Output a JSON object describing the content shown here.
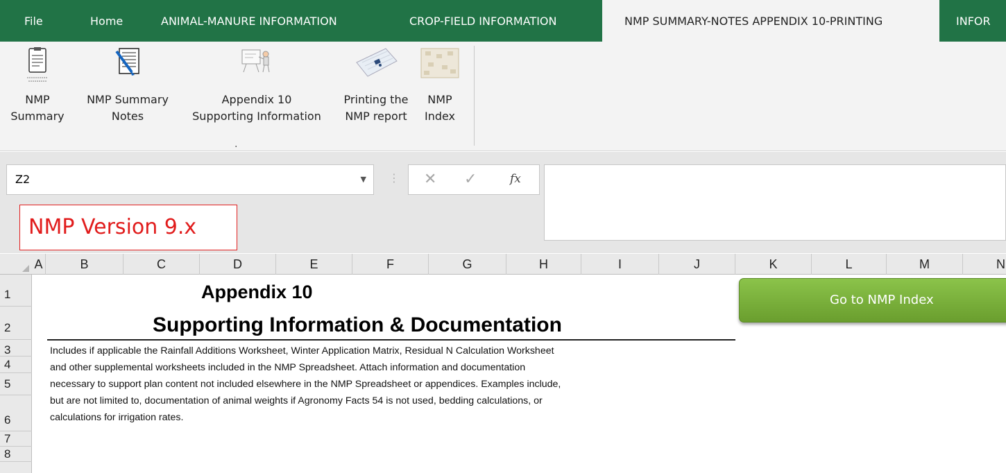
{
  "ribbon_tabs": [
    {
      "label": "File"
    },
    {
      "label": "Home"
    },
    {
      "label": "ANIMAL-MANURE INFORMATION"
    },
    {
      "label": "CROP-FIELD INFORMATION"
    },
    {
      "label": "NMP SUMMARY-NOTES APPENDIX 10-PRINTING",
      "active": true
    },
    {
      "label": "INFOR"
    }
  ],
  "ribbon_buttons": [
    {
      "line1": "NMP",
      "line2": "Summary",
      "icon": "summary-doc-icon"
    },
    {
      "line1": "NMP Summary",
      "line2": "Notes",
      "icon": "notes-doc-icon"
    },
    {
      "line1": "Appendix 10",
      "line2": "Supporting Information",
      "icon": "presentation-icon"
    },
    {
      "line1": "Printing the",
      "line2": "NMP report",
      "icon": "keyboard-icon"
    },
    {
      "line1": "NMP",
      "line2": "Index",
      "icon": "index-cards-icon"
    }
  ],
  "ribbon_group_label": ".",
  "formula_bar": {
    "name_box": "Z2",
    "cancel_glyph": "✕",
    "enter_glyph": "✓",
    "fx_glyph": "fx",
    "formula": ""
  },
  "version_label": "NMP Version 9.x",
  "columns": [
    "A",
    "B",
    "C",
    "D",
    "E",
    "F",
    "G",
    "H",
    "I",
    "J",
    "K",
    "L",
    "M",
    "N"
  ],
  "rows": [
    "1",
    "2",
    "3",
    "4",
    "5",
    "6",
    "7",
    "8"
  ],
  "sheet": {
    "title_line1": "Appendix 10",
    "title_line2": "Supporting Information & Documentation",
    "body_lines": [
      "Includes if applicable the Rainfall Additions Worksheet, Winter Application Matrix, Residual N Calculation Worksheet",
      "and other supplemental worksheets included in the NMP Spreadsheet.  Attach information and documentation",
      "necessary to support plan content not included elsewhere in the NMP Spreadsheet or appendices.  Examples include,",
      "but are not limited to, documentation of animal weights if Agronomy Facts 54 is not used, bedding calculations, or",
      "calculations for irrigation rates."
    ],
    "goto_button": "Go to NMP Index"
  },
  "colors": {
    "ribbon_green": "#217346",
    "version_red": "#e11c1c",
    "button_green": "#7cb342"
  }
}
